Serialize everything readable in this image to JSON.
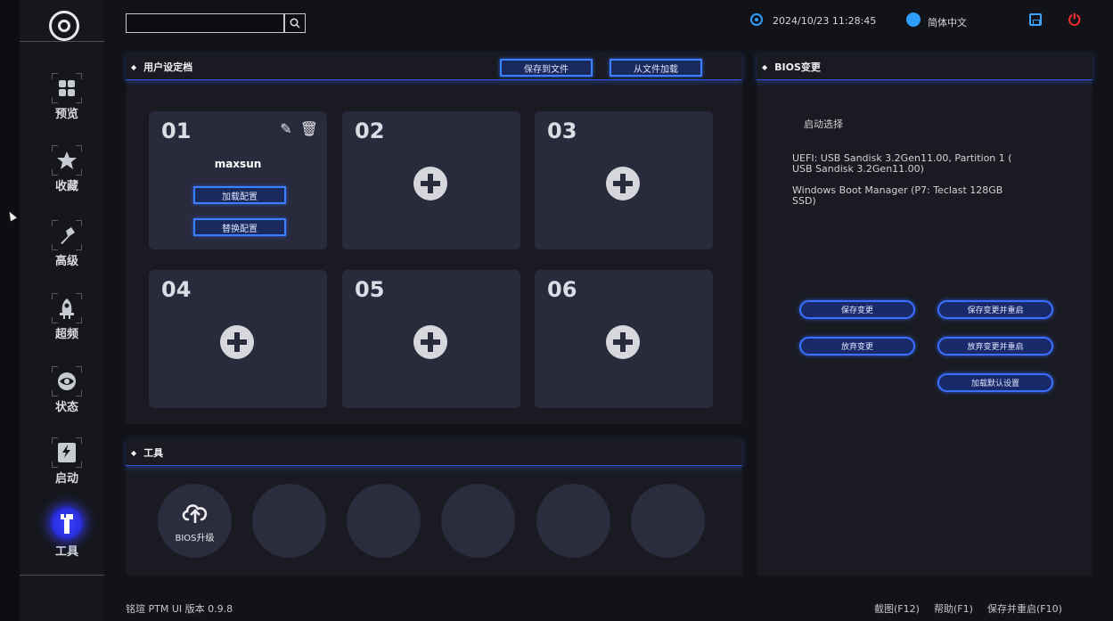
{
  "sidebar": {
    "items": [
      {
        "label": "预览",
        "icon": "grid-icon"
      },
      {
        "label": "收藏",
        "icon": "star-icon"
      },
      {
        "label": "高级",
        "icon": "wrench-icon"
      },
      {
        "label": "超频",
        "icon": "rocket-icon"
      },
      {
        "label": "状态",
        "icon": "status-icon"
      },
      {
        "label": "启动",
        "icon": "ssd-icon"
      },
      {
        "label": "工具",
        "icon": "tools-icon"
      }
    ],
    "active": "工具"
  },
  "topbar": {
    "search_placeholder": "",
    "datetime": "2024/10/23 11:28:45",
    "language": "简体中文"
  },
  "profiles": {
    "title": "用户设定档",
    "save_to_file": "保存到文件",
    "load_from_file": "从文件加载",
    "slots": [
      {
        "num": "01",
        "name": "maxsun",
        "load": "加载配置",
        "replace": "替换配置"
      },
      {
        "num": "02"
      },
      {
        "num": "03"
      },
      {
        "num": "04"
      },
      {
        "num": "05"
      },
      {
        "num": "06"
      }
    ]
  },
  "tools": {
    "title": "工具",
    "items": [
      {
        "label": "BIOS升级",
        "icon": "cloud-upload-icon"
      }
    ]
  },
  "bios": {
    "title": "BIOS变更",
    "boot_heading": "启动选择",
    "boot_entries": [
      "UEFI:  USB Sandisk 3.2Gen11.00, Partition 1 ( USB Sandisk 3.2Gen11.00)",
      "Windows Boot Manager (P7: Teclast 128GB SSD)"
    ],
    "buttons": {
      "save": "保存变更",
      "save_restart": "保存变更并重启",
      "discard": "放弃变更",
      "discard_restart": "放弃变更并重启",
      "load_defaults": "加载默认设置"
    }
  },
  "footer": {
    "version": "铭瑄 PTM UI 版本 0.9.8",
    "screenshot": "截图(F12)",
    "help": "帮助(F1)",
    "save_restart": "保存并重启(F10)"
  },
  "colors": {
    "accent": "#3c7fff",
    "power": "#ff3030",
    "panel": "#1a1b22",
    "slot": "#292a3c"
  }
}
